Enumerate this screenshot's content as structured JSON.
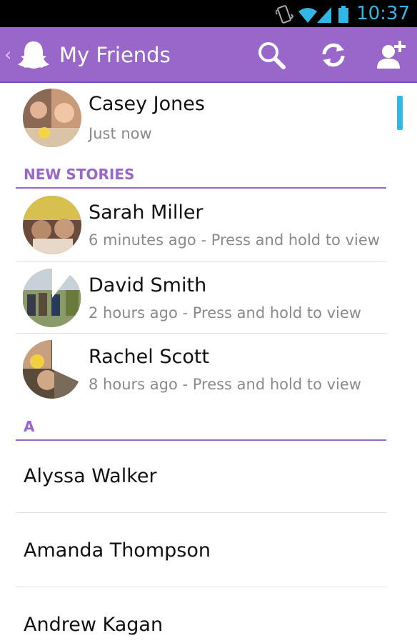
{
  "status_bar": {
    "time": "10:37",
    "accent": "#33b5e5",
    "icons": [
      "vibrate-icon",
      "wifi-icon",
      "signal-icon",
      "battery-icon"
    ]
  },
  "action_bar": {
    "title": "My Friends",
    "color": "#9967c9",
    "buttons": [
      "search-icon",
      "refresh-icon",
      "add-friend-icon"
    ]
  },
  "me": {
    "name": "Casey Jones",
    "status": "Just now"
  },
  "new_stories": {
    "header": "NEW STORIES",
    "items": [
      {
        "name": "Sarah Miller",
        "status": "6 minutes ago - Press and hold to view"
      },
      {
        "name": "David Smith",
        "status": "2 hours ago - Press and hold to view"
      },
      {
        "name": "Rachel Scott",
        "status": "8 hours ago - Press and hold to view"
      }
    ]
  },
  "section_a": {
    "header": "A",
    "items": [
      {
        "name": "Alyssa Walker"
      },
      {
        "name": "Amanda Thompson"
      },
      {
        "name": "Andrew Kagan"
      }
    ]
  }
}
